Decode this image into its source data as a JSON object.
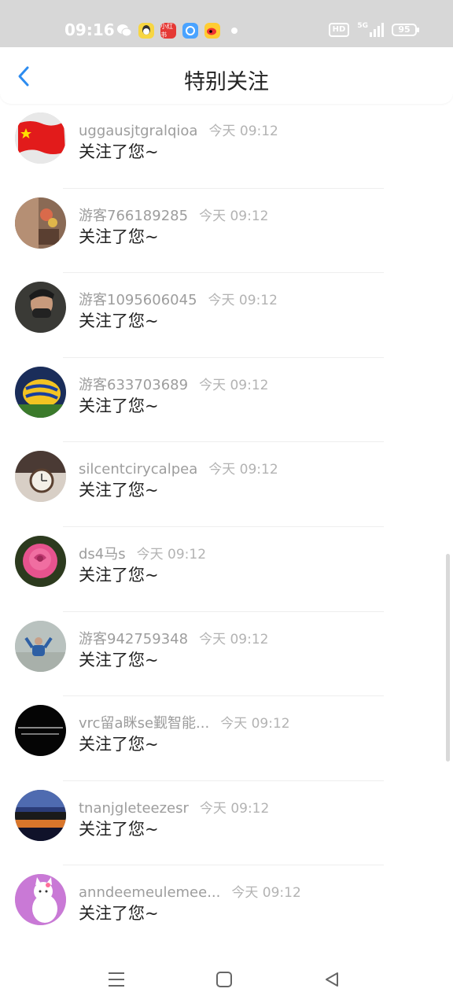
{
  "status_bar": {
    "time": "09:16",
    "notification_icons": [
      "wechat-icon",
      "qq-icon",
      "xiaohongshu-icon",
      "browser-icon",
      "weibo-icon"
    ],
    "xhs_label": "小红书",
    "hd_label": "HD",
    "network_label": "5G",
    "battery_level": "95"
  },
  "header": {
    "title": "特别关注"
  },
  "list": {
    "items": [
      {
        "name": "uggausjtgralqioa",
        "time": "今天 09:12",
        "message": "关注了您~",
        "avatar": "flag"
      },
      {
        "name": "游客766189285",
        "time": "今天 09:12",
        "message": "关注了您~",
        "avatar": "room"
      },
      {
        "name": "游客1095606045",
        "time": "今天 09:12",
        "message": "关注了您~",
        "avatar": "man"
      },
      {
        "name": "游客633703689",
        "time": "今天 09:12",
        "message": "关注了您~",
        "avatar": "fish"
      },
      {
        "name": "silcentcirycalpea",
        "time": "今天 09:12",
        "message": "关注了您~",
        "avatar": "clock"
      },
      {
        "name": "ds4马s",
        "time": "今天 09:12",
        "message": "关注了您~",
        "avatar": "rose"
      },
      {
        "name": "游客942759348",
        "time": "今天 09:12",
        "message": "关注了您~",
        "avatar": "person"
      },
      {
        "name": "vrc留a眯se觐智能...",
        "time": "今天 09:12",
        "message": "关注了您~",
        "avatar": "dark-text"
      },
      {
        "name": "tnanjgleteezesr",
        "time": "今天 09:12",
        "message": "关注了您~",
        "avatar": "sunset"
      },
      {
        "name": "anndeemeulemee...",
        "time": "今天 09:12",
        "message": "关注了您~",
        "avatar": "cat"
      }
    ]
  },
  "colors": {
    "accent": "#2d8cf0",
    "status_bar_bg": "#d7d7d7",
    "name_text": "#9d9d9d",
    "message_text": "#222222"
  }
}
